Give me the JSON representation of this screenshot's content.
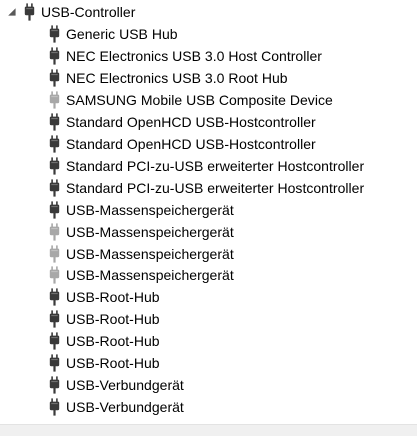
{
  "tree": {
    "category": {
      "label": "USB-Controller",
      "expanded": true,
      "icon": "usb-plug-icon"
    },
    "devices": [
      {
        "label": "Generic USB Hub",
        "icon": "usb-plug-icon",
        "dimmed": false
      },
      {
        "label": "NEC Electronics USB 3.0 Host Controller",
        "icon": "usb-plug-icon",
        "dimmed": false
      },
      {
        "label": "NEC Electronics USB 3.0 Root Hub",
        "icon": "usb-plug-icon",
        "dimmed": false
      },
      {
        "label": "SAMSUNG Mobile USB Composite Device",
        "icon": "usb-plug-icon",
        "dimmed": true
      },
      {
        "label": "Standard OpenHCD USB-Hostcontroller",
        "icon": "usb-plug-icon",
        "dimmed": false
      },
      {
        "label": "Standard OpenHCD USB-Hostcontroller",
        "icon": "usb-plug-icon",
        "dimmed": false
      },
      {
        "label": "Standard PCI-zu-USB erweiterter Hostcontroller",
        "icon": "usb-plug-icon",
        "dimmed": false
      },
      {
        "label": "Standard PCI-zu-USB erweiterter Hostcontroller",
        "icon": "usb-plug-icon",
        "dimmed": false
      },
      {
        "label": "USB-Massenspeichergerät",
        "icon": "usb-plug-icon",
        "dimmed": false
      },
      {
        "label": "USB-Massenspeichergerät",
        "icon": "usb-plug-icon",
        "dimmed": true
      },
      {
        "label": "USB-Massenspeichergerät",
        "icon": "usb-plug-icon",
        "dimmed": true
      },
      {
        "label": "USB-Massenspeichergerät",
        "icon": "usb-plug-icon",
        "dimmed": true
      },
      {
        "label": "USB-Root-Hub",
        "icon": "usb-plug-icon",
        "dimmed": false
      },
      {
        "label": "USB-Root-Hub",
        "icon": "usb-plug-icon",
        "dimmed": false
      },
      {
        "label": "USB-Root-Hub",
        "icon": "usb-plug-icon",
        "dimmed": false
      },
      {
        "label": "USB-Root-Hub",
        "icon": "usb-plug-icon",
        "dimmed": false
      },
      {
        "label": "USB-Verbundgerät",
        "icon": "usb-plug-icon",
        "dimmed": false
      },
      {
        "label": "USB-Verbundgerät",
        "icon": "usb-plug-icon",
        "dimmed": false
      }
    ]
  },
  "colors": {
    "icon_active": "#3a3a3a",
    "icon_dimmed": "#a8a8a8",
    "expander": "#595959",
    "text": "#000000"
  }
}
